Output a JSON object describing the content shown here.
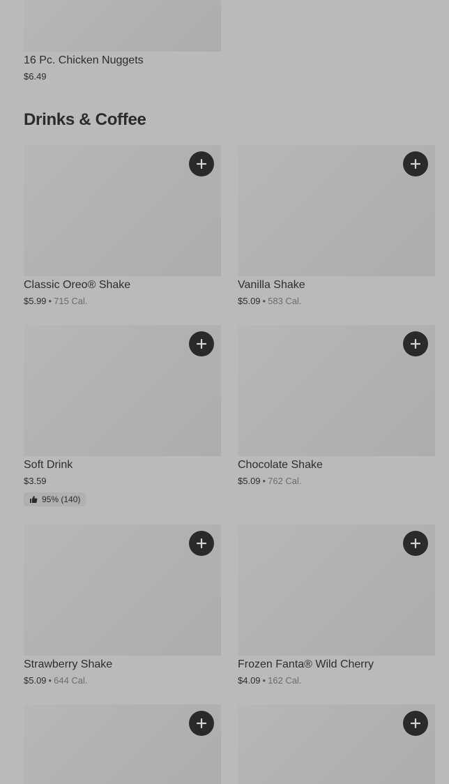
{
  "top_item": {
    "name": "16 Pc. Chicken Nuggets",
    "price": "$6.49"
  },
  "section": {
    "title": "Drinks & Coffee"
  },
  "items": [
    {
      "name": "Classic Oreo® Shake",
      "price": "$5.99",
      "calories": "715 Cal."
    },
    {
      "name": "Vanilla Shake",
      "price": "$5.09",
      "calories": "583 Cal."
    },
    {
      "name": "Soft Drink",
      "price": "$3.59",
      "rating": "95% (140)"
    },
    {
      "name": "Chocolate Shake",
      "price": "$5.09",
      "calories": "762 Cal."
    },
    {
      "name": "Strawberry Shake",
      "price": "$5.09",
      "calories": "644 Cal."
    },
    {
      "name": "Frozen Fanta® Wild Cherry",
      "price": "$4.09",
      "calories": "162 Cal."
    }
  ],
  "separator": "•",
  "icons": {
    "add": "plus-icon",
    "rating": "thumbs-up-icon"
  },
  "colors": {
    "background": "#bababa",
    "add_button": "#2a2a2a"
  }
}
